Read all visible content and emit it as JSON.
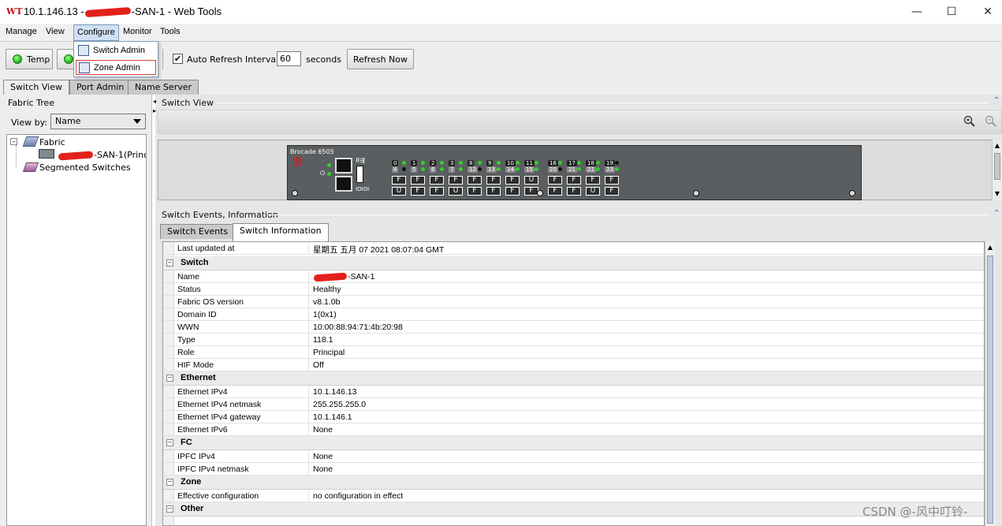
{
  "window": {
    "app_icon": "WT",
    "title_prefix": "10.1.146.13 -",
    "title_suffix": "-SAN-1 - Web Tools",
    "minimize": "—",
    "maximize": "☐",
    "close": "✕"
  },
  "menubar": {
    "items": [
      "Manage",
      "View",
      "Configure",
      "Monitor",
      "Tools"
    ]
  },
  "configure_menu": {
    "items": [
      "Switch Admin",
      "Zone Admin"
    ]
  },
  "toolbar": {
    "temp_label": "Temp",
    "auto_refresh_label": "Auto Refresh",
    "auto_refresh_checked": "✔",
    "interval_label": "Interval",
    "interval_value": "60",
    "seconds_label": "seconds",
    "refresh_now_label": "Refresh Now"
  },
  "tabs": [
    "Switch View",
    "Port Admin",
    "Name Server"
  ],
  "fabric_tree": {
    "title": "Fabric Tree",
    "view_by_label": "View by:",
    "view_by_value": "Name",
    "root": "Fabric",
    "switch_suffix": "-SAN-1(Princi",
    "segmented": "Segmented Switches"
  },
  "switch_view": {
    "title": "Switch View",
    "model": "Brocade 6505",
    "upper_ports": [
      "0",
      "1",
      "2",
      "3",
      "8",
      "9",
      "10",
      "11",
      "16",
      "17",
      "18",
      "19"
    ],
    "lower_ports": [
      "4",
      "5",
      "6",
      "7",
      "12",
      "13",
      "14",
      "15",
      "20",
      "21",
      "22",
      "23"
    ],
    "port_row1": [
      "F",
      "F",
      "F",
      "F",
      "F",
      "F",
      "F",
      "U",
      "F",
      "F",
      "F",
      "F"
    ],
    "port_row2": [
      "U",
      "F",
      "F",
      "U",
      "F",
      "F",
      "F",
      "F",
      "F",
      "F",
      "U",
      "F"
    ]
  },
  "events": {
    "title": "Switch Events, Information",
    "tabs": [
      "Switch Events",
      "Switch Information"
    ]
  },
  "info": {
    "last_updated_label": "Last updated at",
    "last_updated_value": "星期五 五月 07 2021 08:07:04 GMT",
    "groups": [
      {
        "name": "Switch",
        "rows": [
          {
            "k": "Name",
            "v": "-SAN-1"
          },
          {
            "k": "Status",
            "v": "Healthy"
          },
          {
            "k": "Fabric OS version",
            "v": "v8.1.0b"
          },
          {
            "k": "Domain ID",
            "v": "1(0x1)"
          },
          {
            "k": "WWN",
            "v": "10:00:88:94:71:4b:20:98"
          },
          {
            "k": "Type",
            "v": "118.1"
          },
          {
            "k": "Role",
            "v": "Principal"
          },
          {
            "k": "HIF Mode",
            "v": "Off"
          }
        ]
      },
      {
        "name": "Ethernet",
        "rows": [
          {
            "k": "Ethernet IPv4",
            "v": "10.1.146.13"
          },
          {
            "k": "Ethernet IPv4 netmask",
            "v": "255.255.255.0"
          },
          {
            "k": "Ethernet IPv4 gateway",
            "v": "10.1.146.1"
          },
          {
            "k": "Ethernet IPv6",
            "v": "None"
          }
        ]
      },
      {
        "name": "FC",
        "rows": [
          {
            "k": "IPFC IPv4",
            "v": "None"
          },
          {
            "k": "IPFC IPv4 netmask",
            "v": "None"
          }
        ]
      },
      {
        "name": "Zone",
        "rows": [
          {
            "k": "Effective configuration",
            "v": "no configuration in effect"
          }
        ]
      },
      {
        "name": "Other",
        "rows": []
      }
    ]
  },
  "watermark": "CSDN @-风中叮铃-"
}
